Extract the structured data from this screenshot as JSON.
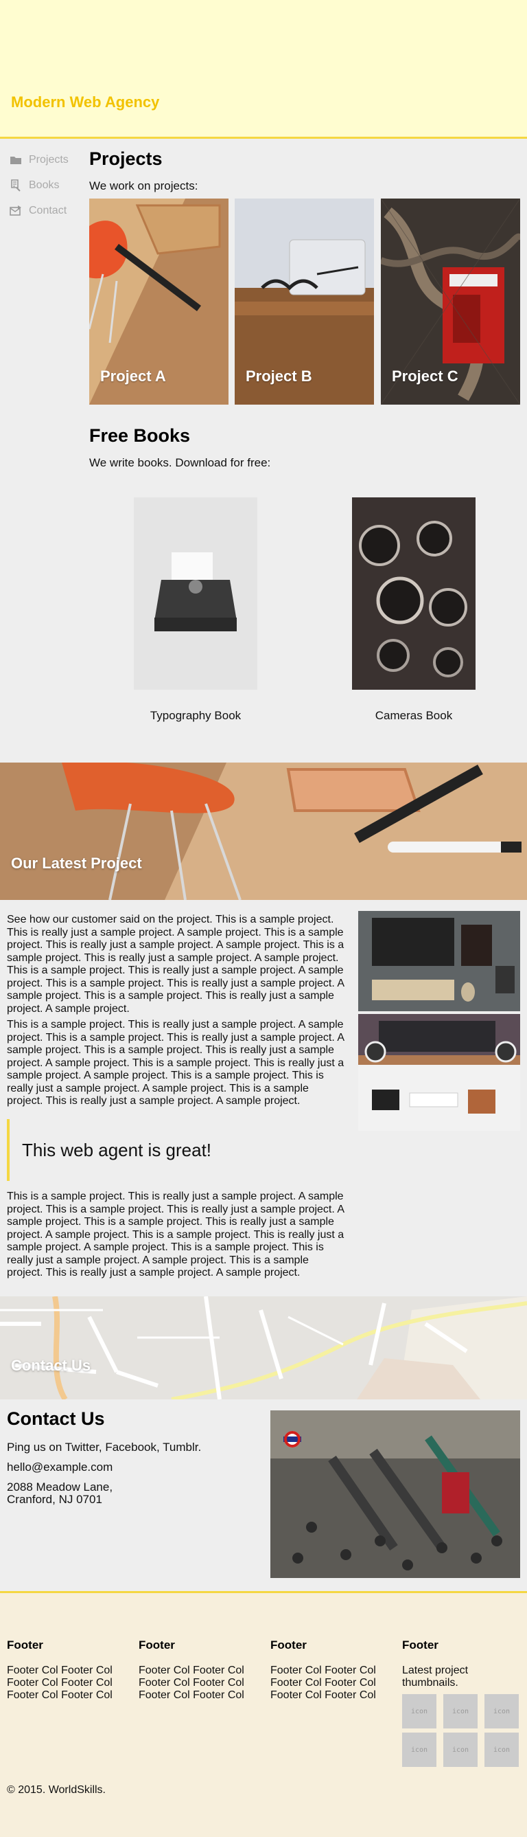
{
  "header": {
    "brand": "Modern Web Agency",
    "accent": "#f5d742",
    "brand_color": "#f2c200"
  },
  "sidebar": {
    "items": [
      {
        "label": "Projects",
        "icon": "folder-icon"
      },
      {
        "label": "Books",
        "icon": "document-icon"
      },
      {
        "label": "Contact",
        "icon": "mail-icon"
      }
    ]
  },
  "projects": {
    "title": "Projects",
    "lead": "We work on projects:",
    "items": [
      {
        "label": "Project A"
      },
      {
        "label": "Project B"
      },
      {
        "label": "Project C"
      }
    ]
  },
  "books": {
    "title": "Free Books",
    "lead": "We write books. Download for free:",
    "items": [
      {
        "caption": "Typography Book"
      },
      {
        "caption": "Cameras Book"
      }
    ]
  },
  "latest": {
    "title": "Our Latest Project",
    "p1": "See how our customer said on the project. This is a sample project. This is really just a sample project. A sample project. This is a sample project. This is really just a sample project. A sample project. This is a sample project. This is really just a sample project. A sample project. This is a sample project. This is really just a sample project. A sample project. This is a sample project. This is really just a sample project. A sample project. This is a sample project. This is really just a sample project. A sample project.",
    "p2": "This is a sample project. This is really just a sample project. A sample project. This is a sample project. This is really just a sample project. A sample project. This is a sample project. This is really just a sample project. A sample project. This is a sample project. This is really just a sample project. A sample project. This is a sample project. This is really just a sample project. A sample project. This is a sample project. This is really just a sample project. A sample project.",
    "quote": "This web agent is great!",
    "p3": "This is a sample project. This is really just a sample project. A sample project. This is a sample project. This is really just a sample project. A sample project. This is a sample project. This is really just a sample project. A sample project. This is a sample project. This is really just a sample project. A sample project. This is a sample project. This is really just a sample project. A sample project. This is a sample project. This is really just a sample project. A sample project."
  },
  "contact": {
    "banner_title": "Contact Us",
    "title": "Contact Us",
    "social": "Ping us on Twitter, Facebook, Tumblr.",
    "email": "hello@example.com",
    "address_line1": "2088 Meadow Lane,",
    "address_line2": "Cranford, NJ 0701"
  },
  "footer": {
    "columns": [
      {
        "heading": "Footer",
        "text": "Footer Col Footer Col Footer Col Footer Col Footer Col Footer Col"
      },
      {
        "heading": "Footer",
        "text": "Footer Col Footer Col Footer Col Footer Col Footer Col Footer Col"
      },
      {
        "heading": "Footer",
        "text": "Footer Col Footer Col Footer Col Footer Col Footer Col Footer Col"
      },
      {
        "heading": "Footer",
        "text": "Latest project thumbnails."
      }
    ],
    "thumb_label": "icon",
    "copyright": "© 2015. WorldSkills."
  }
}
